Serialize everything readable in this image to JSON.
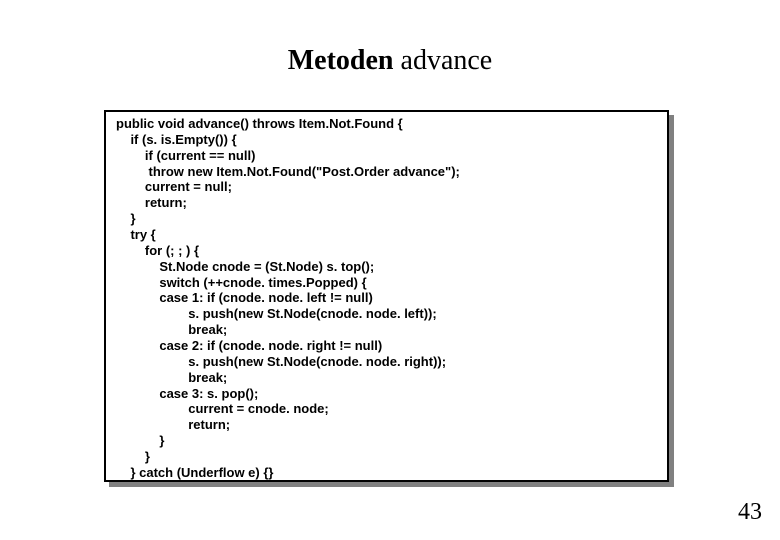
{
  "title_bold": "Metoden",
  "title_normal": " advance",
  "code": "public void advance() throws Item.Not.Found {\n    if (s. is.Empty()) {\n        if (current == null)\n         throw new Item.Not.Found(\"Post.Order advance\");\n        current = null;\n        return;\n    }\n    try {\n        for (; ; ) {\n            St.Node cnode = (St.Node) s. top();\n            switch (++cnode. times.Popped) {\n            case 1: if (cnode. node. left != null)\n                    s. push(new St.Node(cnode. node. left));\n                    break;\n            case 2: if (cnode. node. right != null)\n                    s. push(new St.Node(cnode. node. right));\n                    break;\n            case 3: s. pop();\n                    current = cnode. node;\n                    return;\n            }\n        }\n    } catch (Underflow e) {}\n}",
  "page_number": "43"
}
